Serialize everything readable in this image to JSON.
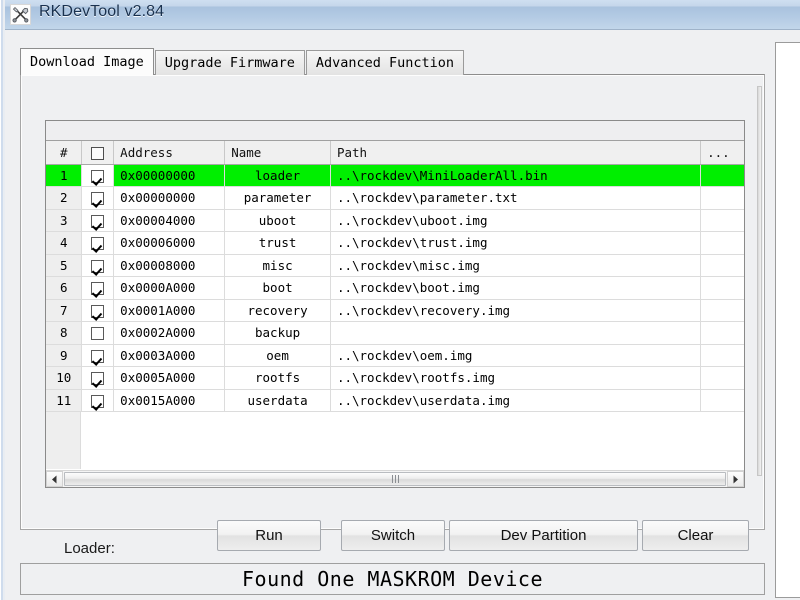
{
  "window": {
    "title": "RKDevTool v2.84",
    "icon": "tools-icon"
  },
  "tabs": [
    {
      "label": "Download Image",
      "active": true
    },
    {
      "label": "Upgrade Firmware",
      "active": false
    },
    {
      "label": "Advanced Function",
      "active": false
    }
  ],
  "grid": {
    "columns": [
      "#",
      "",
      "Address",
      "Name",
      "Path",
      "..."
    ],
    "header_checkbox_checked": false,
    "selected_row_index": 0,
    "selected_row_color": "#00ef00",
    "rows": [
      {
        "num": "1",
        "checked": true,
        "address": "0x00000000",
        "name": "loader",
        "path": "..\\rockdev\\MiniLoaderAll.bin",
        "dots": ""
      },
      {
        "num": "2",
        "checked": true,
        "address": "0x00000000",
        "name": "parameter",
        "path": "..\\rockdev\\parameter.txt",
        "dots": ""
      },
      {
        "num": "3",
        "checked": true,
        "address": "0x00004000",
        "name": "uboot",
        "path": "..\\rockdev\\uboot.img",
        "dots": ""
      },
      {
        "num": "4",
        "checked": true,
        "address": "0x00006000",
        "name": "trust",
        "path": "..\\rockdev\\trust.img",
        "dots": ""
      },
      {
        "num": "5",
        "checked": true,
        "address": "0x00008000",
        "name": "misc",
        "path": "..\\rockdev\\misc.img",
        "dots": ""
      },
      {
        "num": "6",
        "checked": true,
        "address": "0x0000A000",
        "name": "boot",
        "path": "..\\rockdev\\boot.img",
        "dots": ""
      },
      {
        "num": "7",
        "checked": true,
        "address": "0x0001A000",
        "name": "recovery",
        "path": "..\\rockdev\\recovery.img",
        "dots": ""
      },
      {
        "num": "8",
        "checked": false,
        "address": "0x0002A000",
        "name": "backup",
        "path": "",
        "dots": ""
      },
      {
        "num": "9",
        "checked": true,
        "address": "0x0003A000",
        "name": "oem",
        "path": "..\\rockdev\\oem.img",
        "dots": ""
      },
      {
        "num": "10",
        "checked": true,
        "address": "0x0005A000",
        "name": "rootfs",
        "path": "..\\rockdev\\rootfs.img",
        "dots": ""
      },
      {
        "num": "11",
        "checked": true,
        "address": "0x0015A000",
        "name": "userdata",
        "path": "..\\rockdev\\userdata.img",
        "dots": ""
      }
    ]
  },
  "loader": {
    "label": "Loader:",
    "value": ""
  },
  "buttons": {
    "run": "Run",
    "switch": "Switch",
    "dev_partition": "Dev Partition",
    "clear": "Clear"
  },
  "statusbar": {
    "message": "Found One MASKROM Device"
  },
  "log": {
    "lines": []
  }
}
